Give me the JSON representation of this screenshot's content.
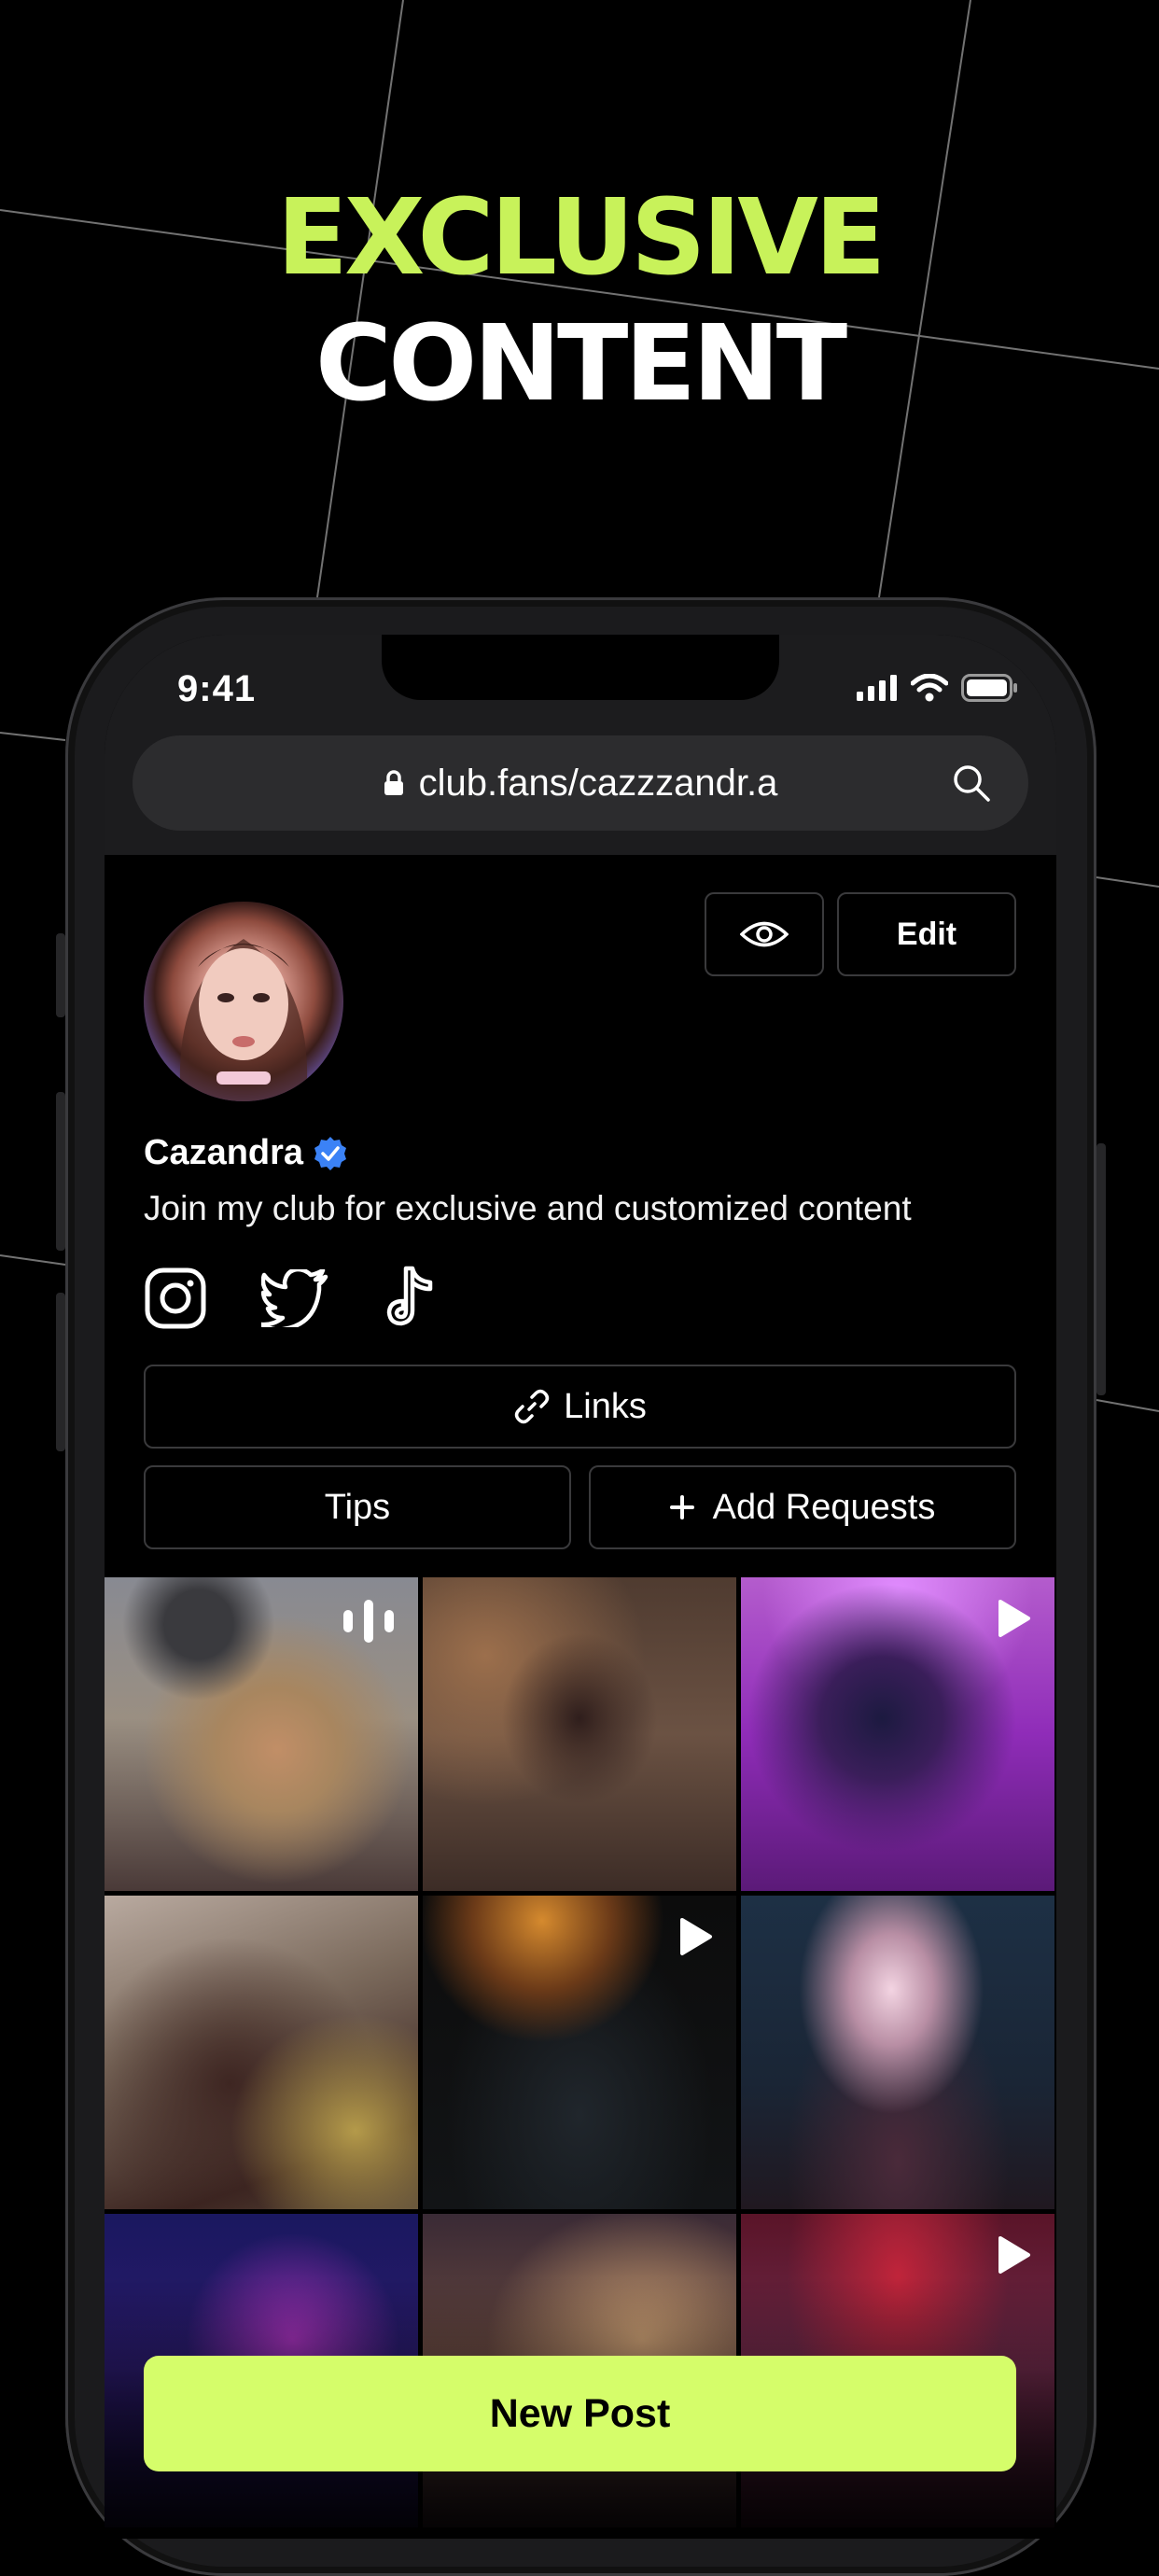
{
  "headline": {
    "line1": "EXCLUSIVE",
    "line2": "CONTENT",
    "accent_color": "#c8f25a"
  },
  "status_bar": {
    "time": "9:41"
  },
  "browser": {
    "url": "club.fans/cazzzandr.a"
  },
  "profile": {
    "name": "Cazandra",
    "verified": true,
    "bio": "Join my club for exclusive and customized content",
    "edit_label": "Edit",
    "socials": [
      "instagram-icon",
      "twitter-icon",
      "tiktok-icon"
    ]
  },
  "actions": {
    "links_label": "Links",
    "tips_label": "Tips",
    "add_requests_label": "Add Requests"
  },
  "posts": [
    {
      "badge": "audio-icon"
    },
    {
      "badge": ""
    },
    {
      "badge": "play-icon"
    },
    {
      "badge": ""
    },
    {
      "badge": "play-icon"
    },
    {
      "badge": ""
    },
    {
      "badge": ""
    },
    {
      "badge": ""
    },
    {
      "badge": "play-icon"
    }
  ],
  "new_post_label": "New Post",
  "colors": {
    "cta": "#d5fd6a",
    "verified": "#3b82f6"
  }
}
